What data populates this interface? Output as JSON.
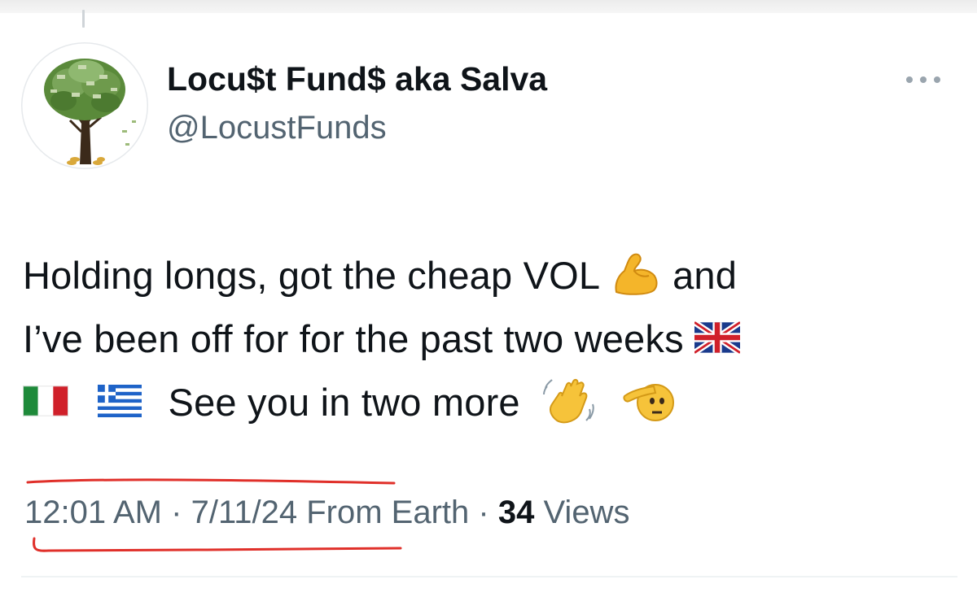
{
  "tweet": {
    "author": {
      "display_name": "Locu$t Fund$ aka Salva",
      "handle": "@LocustFunds",
      "avatar_icon": "money-tree-icon"
    },
    "more_icon": "more-options-icon",
    "text": {
      "line1_a": "Holding longs, got the cheap VOL",
      "line1_b": "and",
      "line2": "I’ve been off for for the past two weeks",
      "line3": "See you in two more"
    },
    "emojis": [
      "flexed-biceps-icon",
      "uk-flag-icon",
      "italy-flag-icon",
      "greece-flag-icon",
      "waving-hand-icon",
      "saluting-face-icon"
    ],
    "meta": {
      "time": "12:01 AM",
      "sep1": "·",
      "date": "7/11/24",
      "source": "From Earth",
      "sep2": "·",
      "views_count": "34",
      "views_label": "Views"
    }
  },
  "colors": {
    "text_primary": "#0f1419",
    "text_secondary": "#536471",
    "annotation_red": "#e0302a"
  }
}
